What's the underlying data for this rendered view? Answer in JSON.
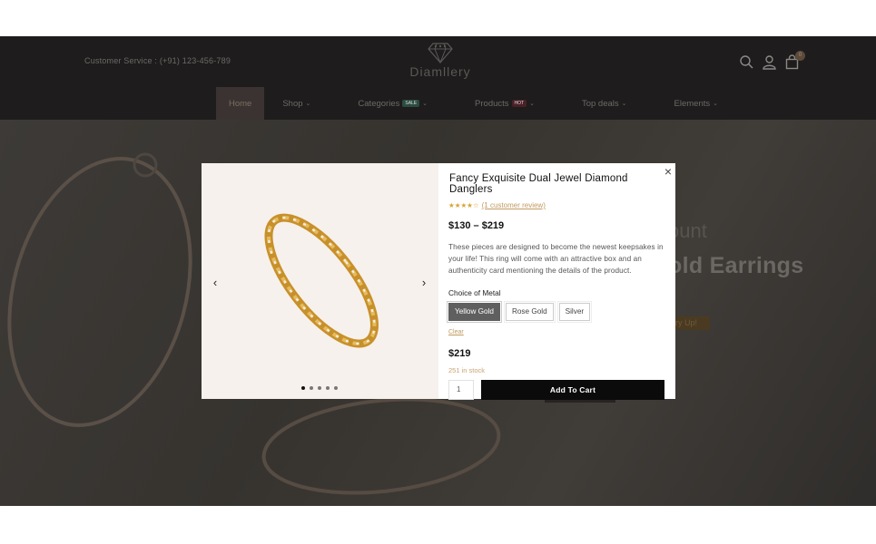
{
  "header": {
    "customer_service": "Customer Service : (+91) 123-456-789",
    "logo_text": "Diamllery",
    "cart_count": "0",
    "icons": [
      "search-icon",
      "user-icon",
      "bag-icon"
    ]
  },
  "nav": {
    "items": [
      {
        "label": "Home",
        "active": true
      },
      {
        "label": "Shop",
        "chevron": "⌄"
      },
      {
        "label": "Categories",
        "badge": "SALE",
        "chevron": "⌄"
      },
      {
        "label": "Products",
        "badge": "HOT",
        "chevron": "⌄"
      },
      {
        "label": "Top deals",
        "chevron": "⌄"
      },
      {
        "label": "Elements",
        "chevron": "⌄"
      }
    ]
  },
  "hero": {
    "subtitle": "ount",
    "title": "old Earrings",
    "button": "ry Up!"
  },
  "modal": {
    "title": "Fancy Exquisite Dual Jewel Diamond Danglers",
    "stars": "★★★★☆",
    "review_link": "(1 customer review)",
    "price_range": "$130 – $219",
    "description": "These pieces are designed to become the newest keepsakes in your life! This ring will come with an attractive box and an authenticity card mentioning the details of the product.",
    "metal_label": "Choice of Metal",
    "metal_options": [
      {
        "label": "Yellow Gold",
        "selected": true
      },
      {
        "label": "Rose Gold",
        "selected": false
      },
      {
        "label": "Silver",
        "selected": false
      }
    ],
    "clear_label": "Clear",
    "price": "$219",
    "stock": "251 in stock",
    "quantity": "1",
    "add_to_cart": "Add To Cart",
    "close_glyph": "×",
    "prev_glyph": "‹",
    "next_glyph": "›",
    "gallery_slide_count": 5,
    "gallery_active_slide": 1
  },
  "colors": {
    "accent": "#c29a61",
    "star": "#d7a534",
    "button": "#0b0b0b"
  }
}
